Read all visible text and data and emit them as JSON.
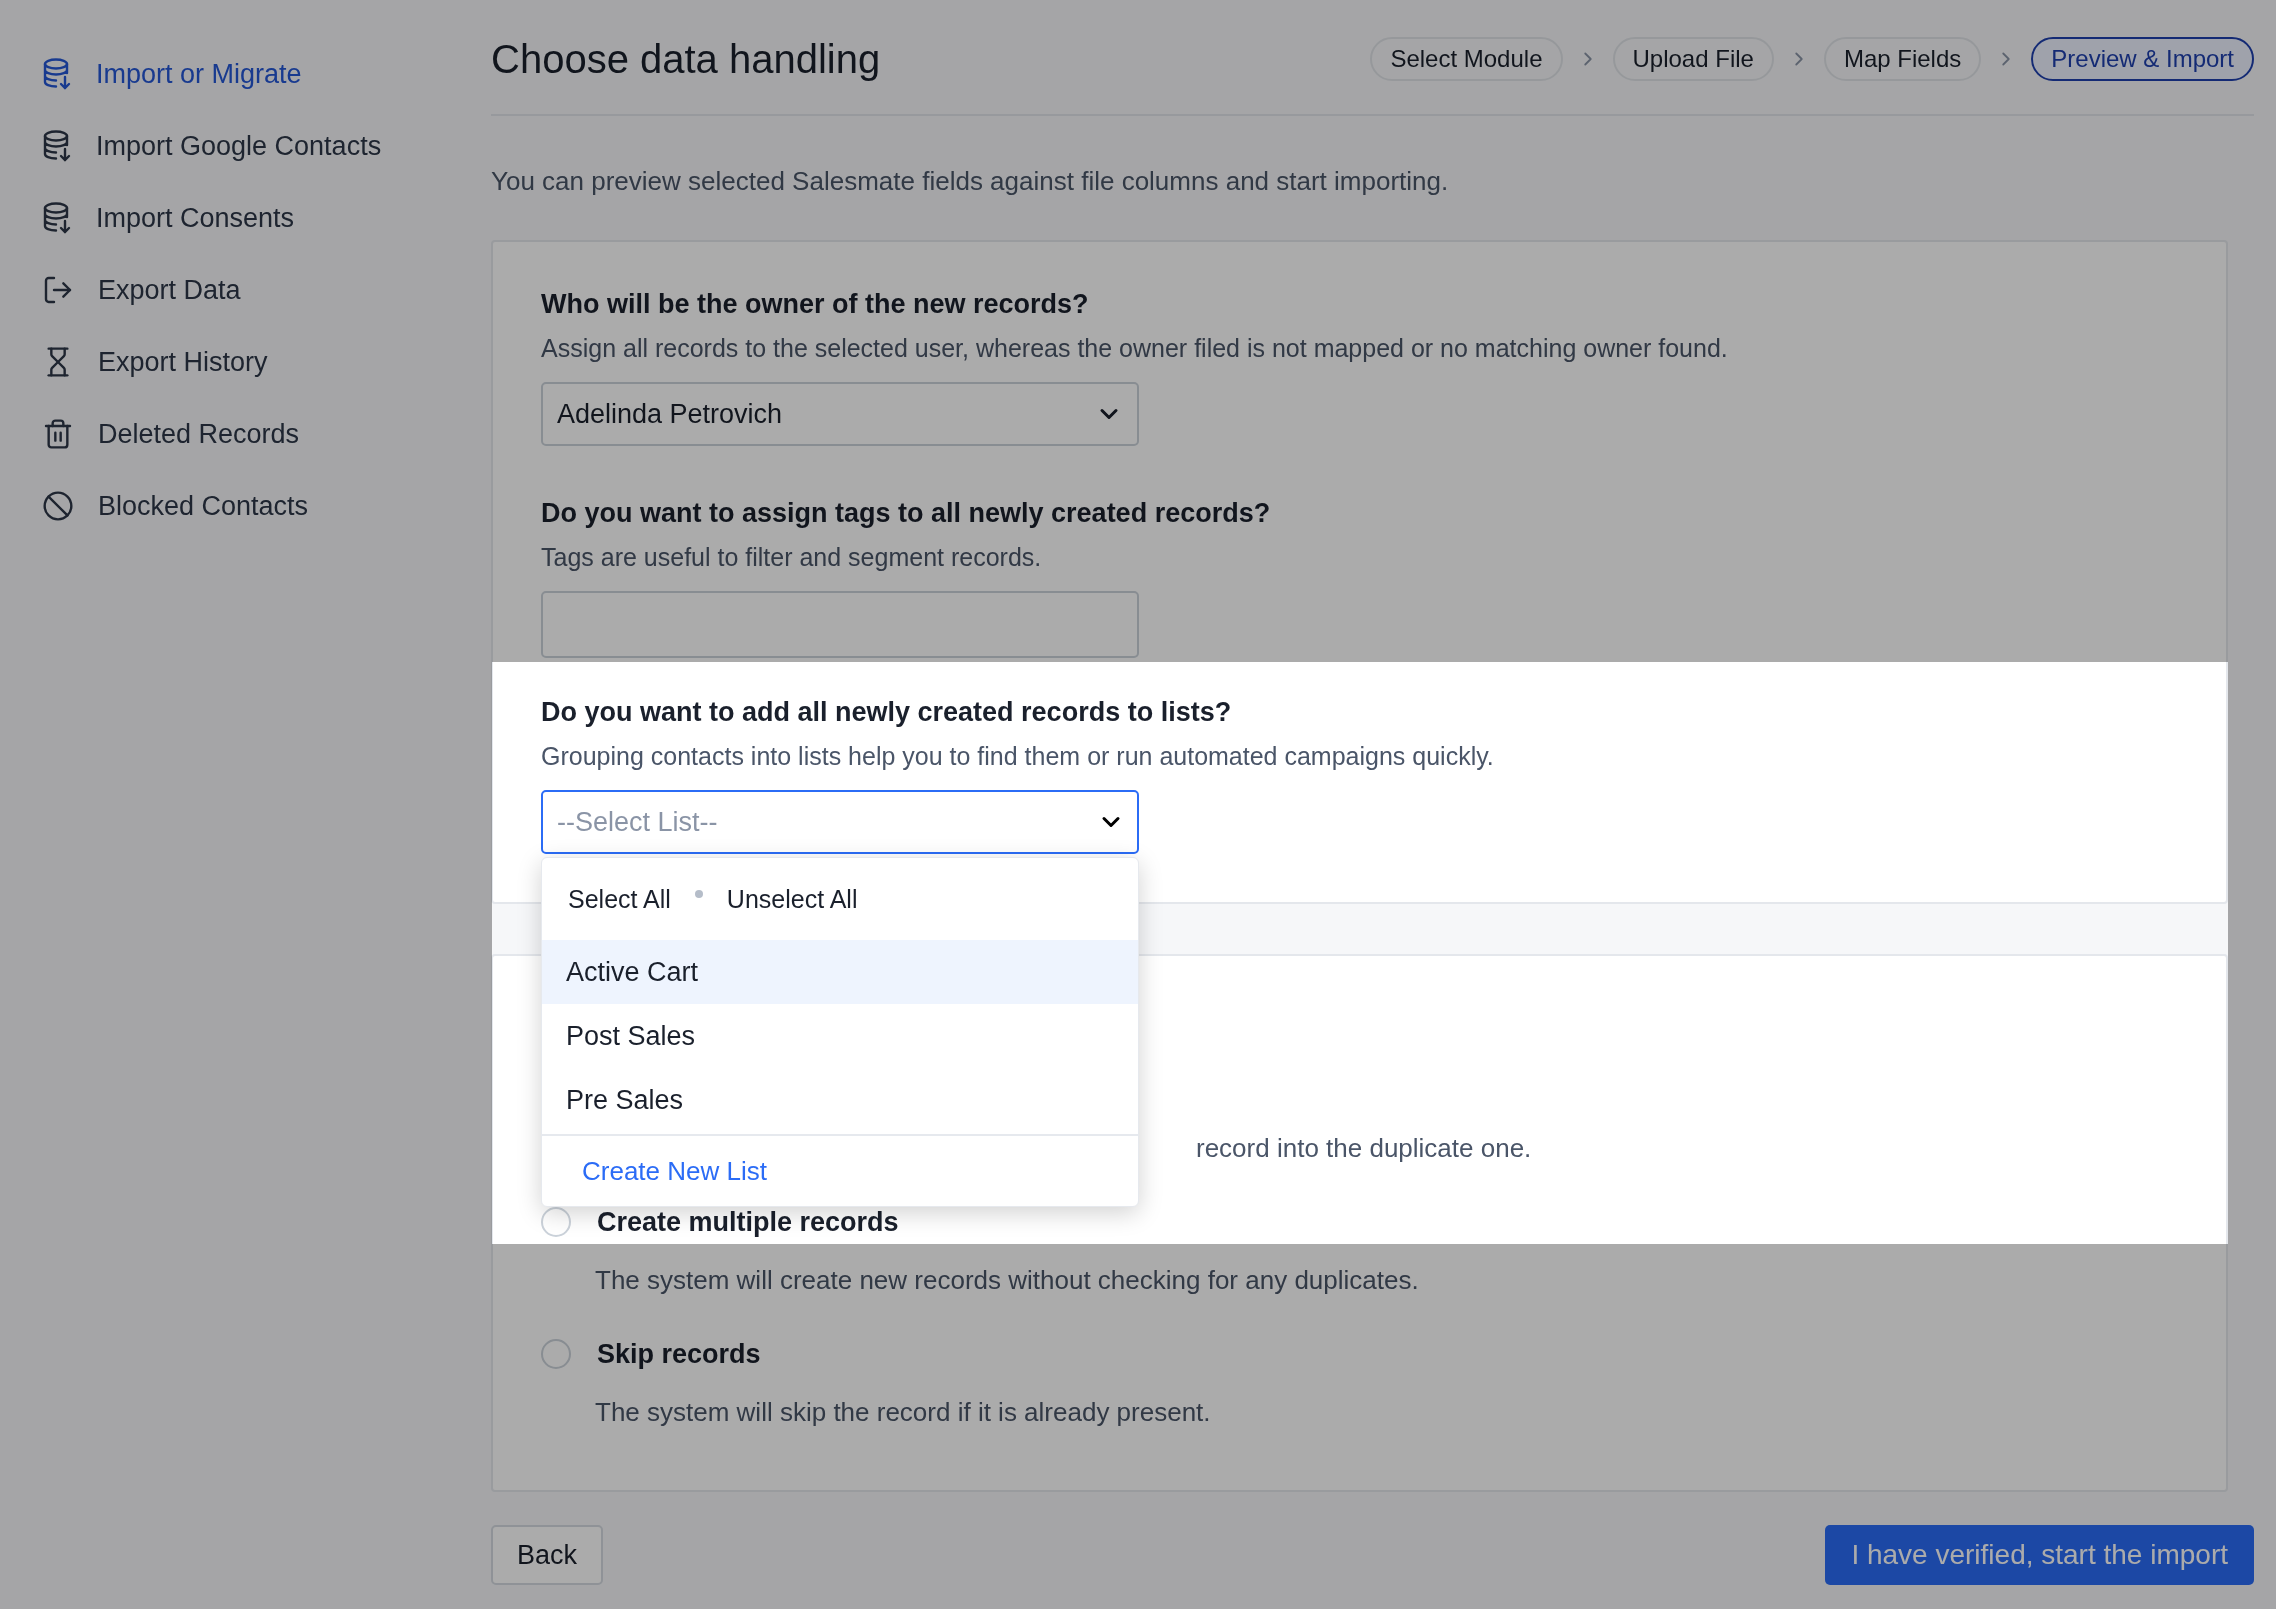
{
  "sidebar": {
    "items": [
      {
        "label": "Import or Migrate",
        "kind": "import",
        "selected": true
      },
      {
        "label": "Import Google Contacts",
        "kind": "import",
        "selected": false
      },
      {
        "label": "Import Consents",
        "kind": "import",
        "selected": false
      },
      {
        "label": "Export Data",
        "kind": "export",
        "selected": false
      },
      {
        "label": "Export History",
        "kind": "history",
        "selected": false
      },
      {
        "label": "Deleted Records",
        "kind": "trash",
        "selected": false
      },
      {
        "label": "Blocked Contacts",
        "kind": "blocked",
        "selected": false
      }
    ]
  },
  "header": {
    "title": "Choose data handling",
    "steps": [
      {
        "label": "Select Module",
        "selected": false
      },
      {
        "label": "Upload File",
        "selected": false
      },
      {
        "label": "Map Fields",
        "selected": false
      },
      {
        "label": "Preview & Import",
        "selected": true
      }
    ],
    "intro": "You can preview selected Salesmate fields against file columns and start importing."
  },
  "owner": {
    "title": "Who will be the owner of the new records?",
    "description": "Assign all records to the selected user, whereas the owner filed is not mapped or no matching owner found.",
    "value": "Adelinda Petrovich"
  },
  "tags": {
    "title": "Do you want to assign tags to all newly created records?",
    "description": "Tags are useful to filter and segment records."
  },
  "lists": {
    "title": "Do you want to add all newly created records to lists?",
    "description": "Grouping contacts into lists help you to find them or run automated campaigns quickly.",
    "placeholder": "--Select List--",
    "menu": {
      "select_all": "Select All",
      "unselect_all": "Unselect All",
      "options": [
        {
          "label": "Active Cart",
          "selected": true
        },
        {
          "label": "Post Sales",
          "selected": false
        },
        {
          "label": "Pre Sales",
          "selected": false
        }
      ],
      "create_label": "Create New List"
    }
  },
  "duplicates": {
    "fragment": "record into the duplicate one.",
    "options": [
      {
        "label": "Create multiple records",
        "description": "The system will create new records without checking for any duplicates.",
        "selected": false
      },
      {
        "label": "Skip records",
        "description": "The system will skip the record if it is already present.",
        "selected": false
      }
    ]
  },
  "buttons": {
    "back": "Back",
    "submit": "I have verified, start the import"
  }
}
